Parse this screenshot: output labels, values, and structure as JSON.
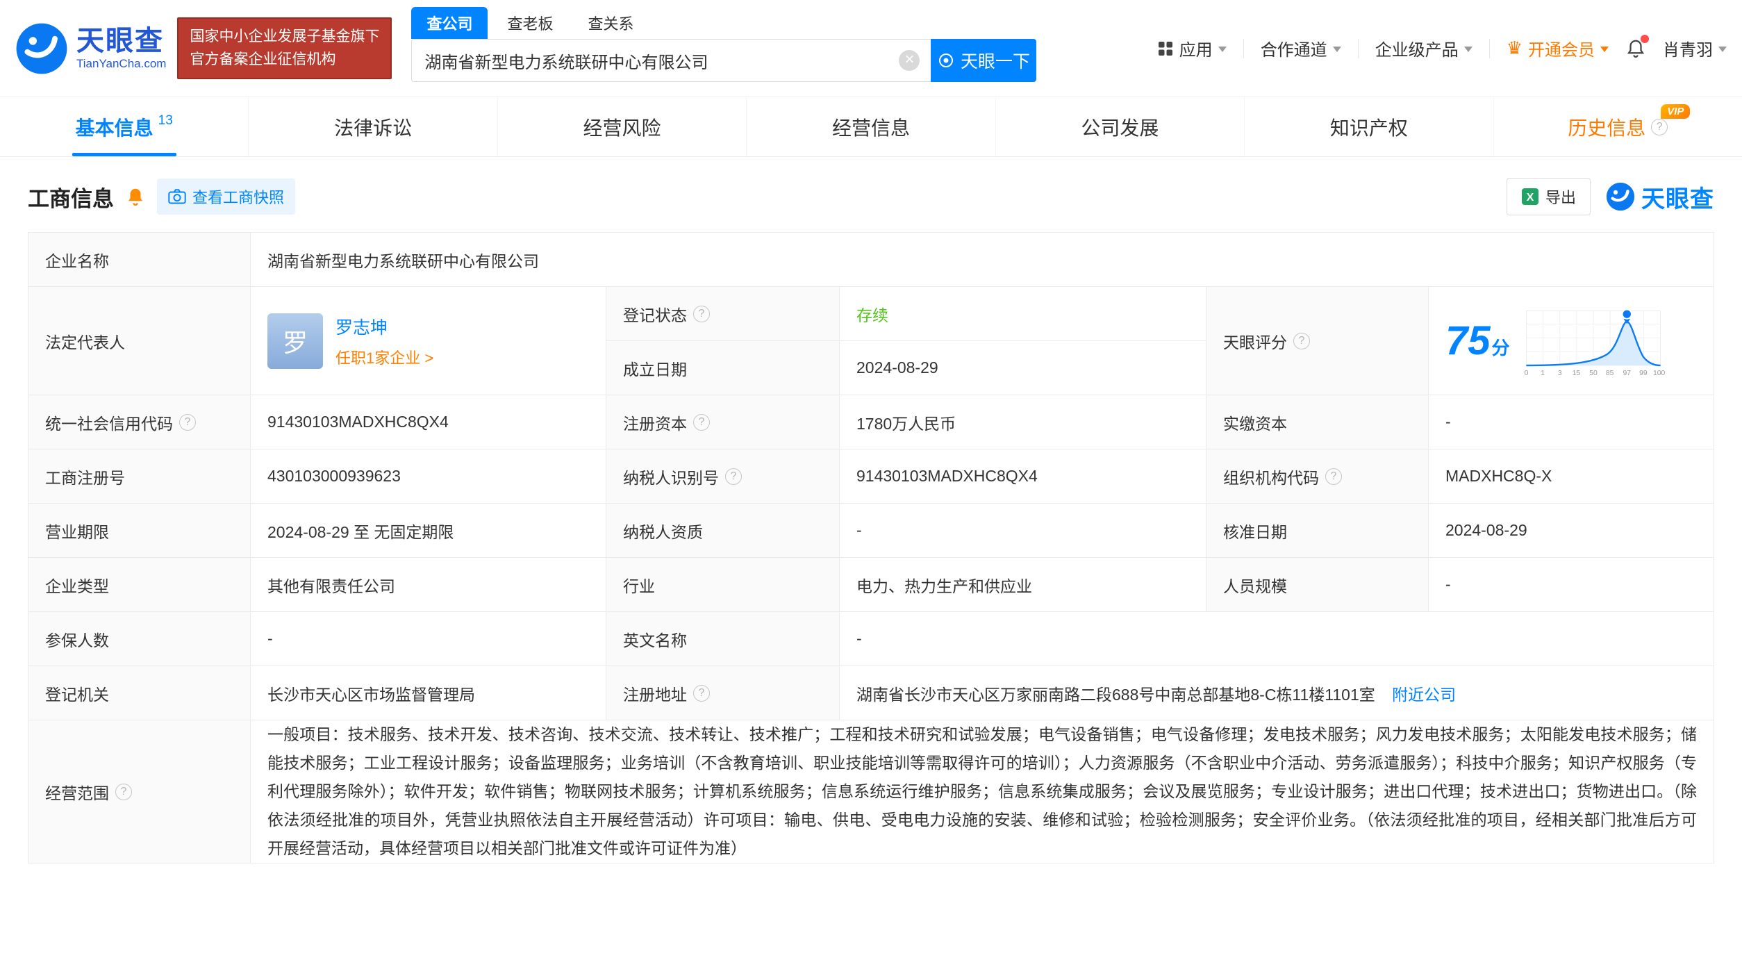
{
  "colors": {
    "accent": "#0084ff",
    "vip_orange": "#ff7a00",
    "status_green": "#52c41a",
    "badge_red": "#b93b2f"
  },
  "header": {
    "logo": {
      "text": "天眼查",
      "domain": "TianYanCha.com"
    },
    "badge": {
      "line1": "国家中小企业发展子基金旗下",
      "line2": "官方备案企业征信机构"
    },
    "search": {
      "tabs": [
        {
          "label": "查公司"
        },
        {
          "label": "查老板"
        },
        {
          "label": "查关系"
        }
      ],
      "value": "湖南省新型电力系统联研中心有限公司",
      "button": "天眼一下"
    },
    "nav": {
      "items": [
        "应用",
        "合作通道",
        "企业级产品",
        "开通会员"
      ]
    },
    "user": {
      "name": "肖青羽"
    }
  },
  "tabs": [
    {
      "label": "基本信息",
      "count": "13"
    },
    {
      "label": "法律诉讼"
    },
    {
      "label": "经营风险"
    },
    {
      "label": "经营信息"
    },
    {
      "label": "公司发展"
    },
    {
      "label": "知识产权"
    },
    {
      "label": "历史信息",
      "vip": "VIP"
    }
  ],
  "section": {
    "title": "工商信息",
    "snapshot": "查看工商快照",
    "export": "导出",
    "brand": "天眼查"
  },
  "fields": {
    "company_name": {
      "label": "企业名称",
      "value": "湖南省新型电力系统联研中心有限公司"
    },
    "legal_rep": {
      "label": "法定代表人",
      "avatar": "罗",
      "name": "罗志坤",
      "tenure": "任职1家企业 >"
    },
    "reg_status": {
      "label": "登记状态",
      "value": "存续"
    },
    "establish_date": {
      "label": "成立日期",
      "value": "2024-08-29"
    },
    "score": {
      "label": "天眼评分",
      "value": "75",
      "unit": "分",
      "axis": [
        "0",
        "1",
        "3",
        "15",
        "50",
        "85",
        "97",
        "99",
        "100"
      ]
    },
    "credit_code": {
      "label": "统一社会信用代码",
      "value": "91430103MADXHC8QX4"
    },
    "reg_capital": {
      "label": "注册资本",
      "value": "1780万人民币"
    },
    "paid_capital": {
      "label": "实缴资本",
      "value": "-"
    },
    "reg_no": {
      "label": "工商注册号",
      "value": "430103000939623"
    },
    "taxpayer_no": {
      "label": "纳税人识别号",
      "value": "91430103MADXHC8QX4"
    },
    "org_code": {
      "label": "组织机构代码",
      "value": "MADXHC8Q-X"
    },
    "business_term": {
      "label": "营业期限",
      "value": "2024-08-29 至 无固定期限"
    },
    "taxpayer_quality": {
      "label": "纳税人资质",
      "value": "-"
    },
    "approval_date": {
      "label": "核准日期",
      "value": "2024-08-29"
    },
    "company_type": {
      "label": "企业类型",
      "value": "其他有限责任公司"
    },
    "industry": {
      "label": "行业",
      "value": "电力、热力生产和供应业"
    },
    "staff_size": {
      "label": "人员规模",
      "value": "-"
    },
    "insured": {
      "label": "参保人数",
      "value": "-"
    },
    "english_name": {
      "label": "英文名称",
      "value": "-"
    },
    "reg_authority": {
      "label": "登记机关",
      "value": "长沙市天心区市场监督管理局"
    },
    "reg_address": {
      "label": "注册地址",
      "value": "湖南省长沙市天心区万家丽南路二段688号中南总部基地8-C栋11楼1101室",
      "link": "附近公司"
    },
    "business_scope": {
      "label": "经营范围",
      "value": "一般项目：技术服务、技术开发、技术咨询、技术交流、技术转让、技术推广；工程和技术研究和试验发展；电气设备销售；电气设备修理；发电技术服务；风力发电技术服务；太阳能发电技术服务；储能技术服务；工业工程设计服务；设备监理服务；业务培训（不含教育培训、职业技能培训等需取得许可的培训）；人力资源服务（不含职业中介活动、劳务派遣服务）；科技中介服务；知识产权服务（专利代理服务除外）；软件开发；软件销售；物联网技术服务；计算机系统服务；信息系统运行维护服务；信息系统集成服务；会议及展览服务；专业设计服务；进出口代理；技术进出口；货物进出口。（除依法须经批准的项目外，凭营业执照依法自主开展经营活动）许可项目：输电、供电、受电电力设施的安装、维修和试验；检验检测服务；安全评价业务。（依法须经批准的项目，经相关部门批准后方可开展经营活动，具体经营项目以相关部门批准文件或许可证件为准）"
    }
  }
}
